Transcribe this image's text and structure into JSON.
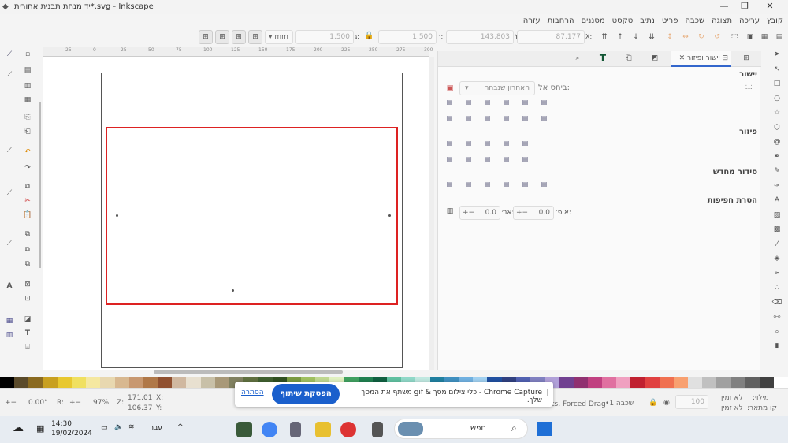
{
  "window": {
    "title": "יד מנחת תבנית אחורית*.svg - Inkscape",
    "minimize": "—",
    "maximize": "❐",
    "close": "✕"
  },
  "menu": [
    "קובץ",
    "עריכה",
    "תצוגה",
    "שכבה",
    "פריט",
    "נתיב",
    "טקסט",
    "מסננים",
    "הרחבות",
    "עזרה"
  ],
  "toolbar": {
    "x_label": "X:",
    "x_value": "87.177",
    "y_label": "Y:",
    "y_value": "143.803",
    "w_label": "ר:",
    "w_value": "1.500",
    "h_label": "ג:",
    "h_value": "1.500",
    "unit": "mm"
  },
  "panel": {
    "tab_active": "יישור ופיזור",
    "tab_close": "✕",
    "align_title": "יישור",
    "relative_label": "ביחס אל:",
    "relative_value": "האחרון שנבחר",
    "distribute_title": "פיזור",
    "rearrange_title": "סידור מחדש",
    "overlap_title": "הסרת חפיפות",
    "h_label": "אופ׳:",
    "h_value": "0.0",
    "v_label": "אנ׳:",
    "v_value": "0.0"
  },
  "palette": [
    "#000",
    "#5a4a2a",
    "#8a6a20",
    "#c8a020",
    "#e8c830",
    "#f0e060",
    "#f5e8a0",
    "#e8d8b0",
    "#d8b890",
    "#c89870",
    "#b07848",
    "#905030",
    "#d0b8a0",
    "#e8e0d0",
    "#c8c0a8",
    "#a89878",
    "#808060",
    "#607040",
    "#406030",
    "#305020",
    "#7a9a40",
    "#a0c060",
    "#c0d890",
    "#e0f0c0",
    "#40a060",
    "#208050",
    "#106040",
    "#60c0a0",
    "#90d8c8",
    "#c0e8e0",
    "#2080a0",
    "#4090c0",
    "#70b0e0",
    "#a0d0f0",
    "#2050a0",
    "#304080",
    "#5060b0",
    "#8080c0",
    "#b0a0d8",
    "#704090",
    "#903070",
    "#c04080",
    "#e070a0",
    "#f0a0c0",
    "#c02030",
    "#e04040",
    "#f07050",
    "#f8a070",
    "#e0e0e0",
    "#c0c0c0",
    "#a0a0a0",
    "#808080",
    "#606060",
    "#404040",
    "#fff"
  ],
  "status": {
    "rotation": "0.00°",
    "r_label": "R:",
    "zoom": "97%",
    "z_label": "Z:",
    "cx": "171.01",
    "cy": "106.37",
    "x_label": "X:",
    "y_label": "Y:",
    "mode_text": "ts, Forced Drag",
    "layer": "•שכבה 1",
    "opacity": "100",
    "fill_label": "מילוי:",
    "fill_value": "לא זמין",
    "stroke_label": "קו מתאר:",
    "stroke_value": "לא זמין"
  },
  "capture": {
    "hide": "הסתרה",
    "stop": "הפסקת שיתוף",
    "message": "Chrome Capture - כלי צילום מסך & gif משתף את המסך שלך."
  },
  "taskbar": {
    "time": "14:30",
    "date": "19/02/2024",
    "lang": "עבר",
    "search_placeholder": "חפש"
  }
}
